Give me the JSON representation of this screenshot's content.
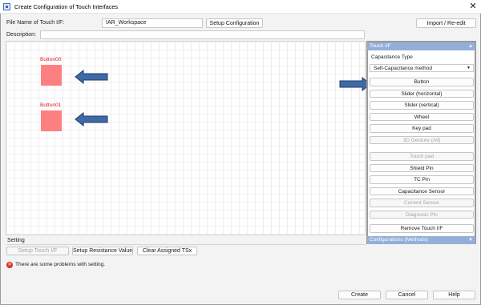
{
  "window": {
    "title": "Create Configuration of Touch Interfaces"
  },
  "form": {
    "file_label": "File Name of Touch I/F:",
    "file_value": "IAR_Workspace",
    "setup_config": "Setup Configuration",
    "import_reedit": "Import / Re-edit",
    "description_label": "Description:",
    "description_value": ""
  },
  "canvas": {
    "items": [
      {
        "label": "Button00",
        "color": "#fd8080"
      },
      {
        "label": "Button01",
        "color": "#fd8080"
      }
    ]
  },
  "panel": {
    "title": "Touch I/F",
    "capacitance_type_label": "Capacitance Type",
    "capacitance_type_value": "Self-Capacitance method",
    "buttons": [
      {
        "label": "Button",
        "enabled": true
      },
      {
        "label": "Slider (horizontal)",
        "enabled": true
      },
      {
        "label": "Slider (vertical)",
        "enabled": true
      },
      {
        "label": "Wheel",
        "enabled": true
      },
      {
        "label": "Key pad",
        "enabled": true
      },
      {
        "label": "3D Gesture (All)",
        "enabled": false
      },
      {
        "label": "Touch pad",
        "enabled": false
      },
      {
        "label": "Shield Pin",
        "enabled": true
      },
      {
        "label": "TC Pin",
        "enabled": true
      },
      {
        "label": "Capacitance Sensor",
        "enabled": true
      },
      {
        "label": "Current Sensor",
        "enabled": false
      },
      {
        "label": "Diagnosis Pin",
        "enabled": false
      },
      {
        "label": "Remove Touch I/F",
        "enabled": true
      }
    ],
    "footer": "Configurations (Methods)"
  },
  "settings": {
    "label": "Setting",
    "setup_touch": "Setup Touch I/F",
    "setup_resistance": "Setup Resistance Value",
    "clear_assigned": "Clear Assigned TSx"
  },
  "status": {
    "message": "There are some problems with setting."
  },
  "footer": {
    "create": "Create",
    "cancel": "Cancel",
    "help": "Help"
  },
  "colors": {
    "accent": "#93afd9",
    "arrow": "#3f6aa8",
    "error": "#d9342b"
  }
}
